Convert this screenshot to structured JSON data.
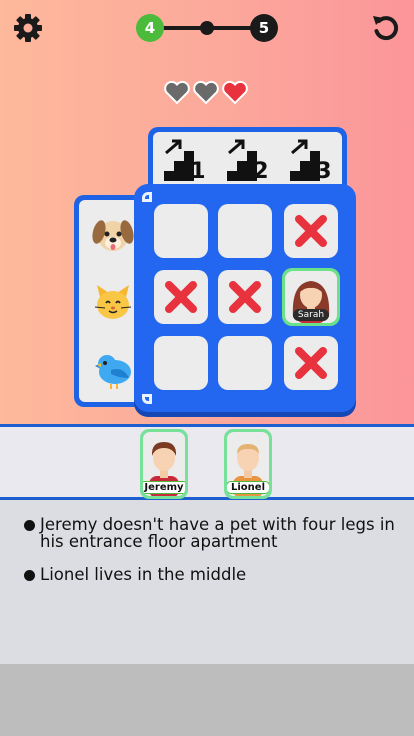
{
  "header": {
    "current_level": "4",
    "next_level": "5"
  },
  "lives": {
    "total": 3,
    "remaining": 1
  },
  "floors": [
    {
      "number": "1"
    },
    {
      "number": "2"
    },
    {
      "number": "3"
    }
  ],
  "pets": [
    "dog-icon",
    "cat-icon",
    "bird-icon"
  ],
  "grid": {
    "rows": [
      [
        "empty",
        "empty",
        "cross"
      ],
      [
        "cross",
        "cross",
        "placed"
      ],
      [
        "empty",
        "empty",
        "cross"
      ]
    ],
    "placed_name": "Sarah"
  },
  "tray": {
    "characters": [
      {
        "name": "Jeremy"
      },
      {
        "name": "Lionel"
      }
    ]
  },
  "clues": [
    "Jeremy doesn't have a pet with four legs in his entrance floor apartment",
    "Lionel lives in the middle"
  ],
  "colors": {
    "accent_blue": "#2367f0",
    "level_green": "#4cbb3b",
    "cross_red": "#e8323d",
    "card_green": "#77e19a"
  }
}
